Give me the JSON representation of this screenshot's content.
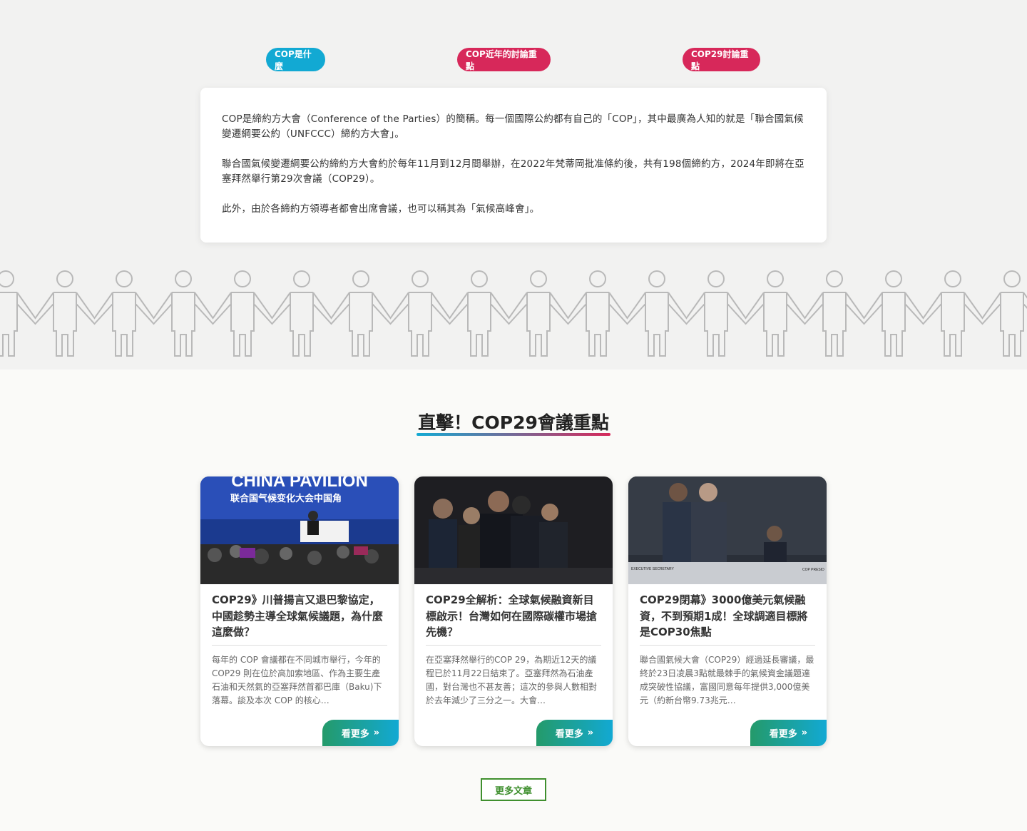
{
  "tabs": [
    {
      "label": "COP是什麼",
      "color": "#12a9d3"
    },
    {
      "label": "COP近年的討論重點",
      "color": "#d7285a"
    },
    {
      "label": "COP29討論重點",
      "color": "#d7285a"
    }
  ],
  "intro": {
    "paragraphs": [
      "COP是締約方大會（Conference of the Parties）的簡稱。每一個國際公約都有自己的「COP」，其中最廣為人知的就是「聯合國氣候變遷綱要公約（UNFCCC）締約方大會」。",
      "聯合國氣候變遷綱要公約締約方大會約於每年11月到12月間舉辦，在2022年梵蒂岡批准條約後，共有198個締約方，2024年即將在亞塞拜然舉行第29次會議（COP29）。",
      "此外，由於各締約方領導者都會出席會議，也可以稱其為「氣候高峰會」。"
    ]
  },
  "section": {
    "title": "直擊！COP29會議重點"
  },
  "articles": [
    {
      "title": "COP29》川普揚言又退巴黎協定，中國趁勢主導全球氣候議題，為什麼這麼做？",
      "excerpt": "每年的 COP 會議都在不同城市舉行，今年的 COP29 則在位於高加索地區、作為主要生產石油和天然氣的亞塞拜然首都巴庫（Baku)下落幕。談及本次 COP 的核心…",
      "more_label": "看更多",
      "image_banner_line1": "CHINA PAVILION",
      "image_banner_line2": "联合国气候变化大会中国角"
    },
    {
      "title": "COP29全解析：全球氣候融資新目標啟示！台灣如何在國際碳權市場搶先機？",
      "excerpt": "在亞塞拜然舉行的COP 29，為期近12天的議程已於11月22日結束了。亞塞拜然為石油產國，對台灣也不甚友善；這次的參與人數相對於去年減少了三分之一。大會…",
      "more_label": "看更多"
    },
    {
      "title": "COP29閉幕》3000億美元氣候融資，不到預期1成！全球調適目標將是COP30焦點",
      "excerpt": "聯合國氣候大會（COP29）經過延長審議，最終於23日凌晨3點就最棘手的氣候資金議題達成突破性協議，富國同意每年提供3,000億美元（約新台幣9.73兆元…",
      "more_label": "看更多",
      "image_caption_left": "EXECUTIVE SECRETARY",
      "image_caption_right": "COP PRESID"
    }
  ],
  "more_articles_label": "更多文章",
  "colors": {
    "accent_blue": "#12a9d3",
    "accent_red": "#d7285a",
    "green": "#3f8f2e"
  }
}
